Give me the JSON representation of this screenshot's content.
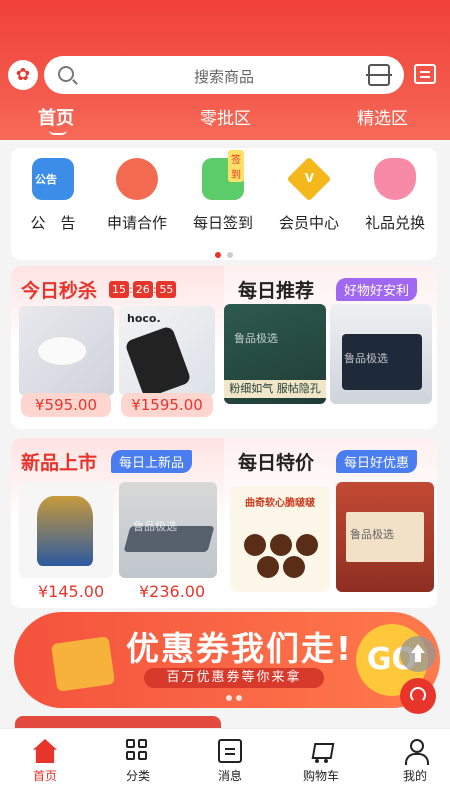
{
  "header": {
    "search_placeholder": "搜索商品",
    "tabs": [
      {
        "label": "首页"
      },
      {
        "label": "零批区"
      },
      {
        "label": "精选区"
      }
    ]
  },
  "shortcuts": [
    {
      "label": "公　告",
      "icon": "notice-icon",
      "badge": "公告",
      "color": "#3b8de8"
    },
    {
      "label": "申请合作",
      "icon": "partner-icon",
      "color": "#f26a4f"
    },
    {
      "label": "每日签到",
      "icon": "checkin-icon",
      "badge": "签到",
      "color": "#5ccb6a"
    },
    {
      "label": "会员中心",
      "icon": "vip-icon",
      "badge": "V",
      "color": "#f5b81c"
    },
    {
      "label": "礼品兑换",
      "icon": "gift-exchange-icon",
      "color": "#f78aa6"
    }
  ],
  "flash_sale": {
    "title": "今日秒杀",
    "timer": [
      "15",
      "26",
      "55"
    ],
    "products": [
      {
        "name": "tableware-set",
        "price": "¥595.00"
      },
      {
        "name": "hoco-earphones",
        "price": "¥1595.00"
      }
    ]
  },
  "daily_recommend": {
    "title": "每日推荐",
    "tag": "好物好安利",
    "products": [
      {
        "name": "gift-box",
        "caption": "粉细如气 服帖隐孔"
      },
      {
        "name": "laptop-bag"
      }
    ]
  },
  "new_arrivals": {
    "title": "新品上市",
    "tag": "每日上新品",
    "products": [
      {
        "name": "hotpot",
        "price": "¥145.00"
      },
      {
        "name": "folding-bed",
        "price": "¥236.00"
      }
    ]
  },
  "daily_special": {
    "title": "每日特价",
    "tag": "每日好优惠",
    "products": [
      {
        "name": "chocolate-box",
        "caption": "曲奇软心脆啵啵"
      },
      {
        "name": "art-set"
      }
    ]
  },
  "watermark": "鲁品极选",
  "coupon": {
    "title": "优惠券我们走!",
    "subtitle": "百万优惠券等你来拿",
    "go": "GO"
  },
  "colors": {
    "brand": "#e8352c",
    "tag_blue": "#4a7df0",
    "tag_purple": "#a067f0"
  },
  "tabbar": [
    {
      "label": "首页",
      "icon": "home-icon"
    },
    {
      "label": "分类",
      "icon": "category-icon"
    },
    {
      "label": "消息",
      "icon": "message-icon"
    },
    {
      "label": "购物车",
      "icon": "cart-icon"
    },
    {
      "label": "我的",
      "icon": "profile-icon"
    }
  ]
}
